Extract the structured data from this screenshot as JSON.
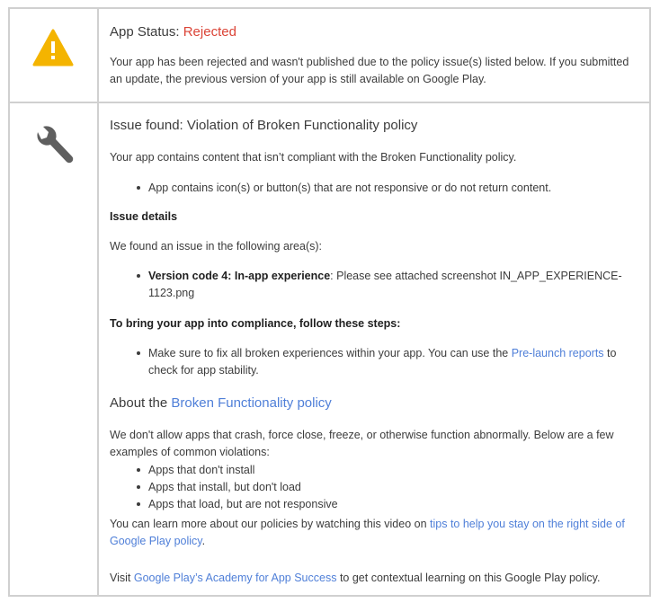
{
  "status": {
    "heading_prefix": "App Status: ",
    "heading_status": "Rejected",
    "description": "Your app has been rejected and wasn't published due to the policy issue(s) listed below. If you submitted an update, the previous version of your app is still available on Google Play.",
    "icon": "warning-icon",
    "status_color": "#db4437",
    "icon_color": "#f4b400"
  },
  "issue": {
    "icon": "wrench-icon",
    "heading": "Issue found: Violation of Broken Functionality policy",
    "intro": "Your app contains content that isn’t compliant with the Broken Functionality policy.",
    "intro_bullets": [
      "App contains icon(s) or button(s) that are not responsive or do not return content."
    ],
    "details_heading": "Issue details",
    "details_intro": "We found an issue in the following area(s):",
    "detail_item": {
      "bold": "Version code 4: In-app experience",
      "rest": ": Please see attached screenshot IN_APP_EXPERIENCE-1123.png"
    },
    "steps_heading": "To bring your app into compliance, follow these steps:",
    "step_item": {
      "before": "Make sure to fix all broken experiences within your app. You can use the ",
      "link": "Pre-launch reports",
      "after": " to check for app stability."
    }
  },
  "about": {
    "heading_prefix": "About the ",
    "heading_link": "Broken Functionality policy",
    "paragraph": "We don't allow apps that crash, force close, freeze, or otherwise function abnormally. Below are a few examples of common violations:",
    "examples": [
      "Apps that don't install",
      "Apps that install, but don't load",
      "Apps that load, but are not responsive"
    ],
    "video_before": "You can learn more about our policies by watching this video on ",
    "video_link": "tips to help you stay on the right side of Google Play policy",
    "video_after": ".",
    "academy_before": "Visit ",
    "academy_link": "Google Play’s Academy for App Success",
    "academy_after": " to get contextual learning on this Google Play policy."
  },
  "colors": {
    "link": "#4f7fd8",
    "border": "#d0d0d0",
    "text": "#3c3c3c"
  }
}
